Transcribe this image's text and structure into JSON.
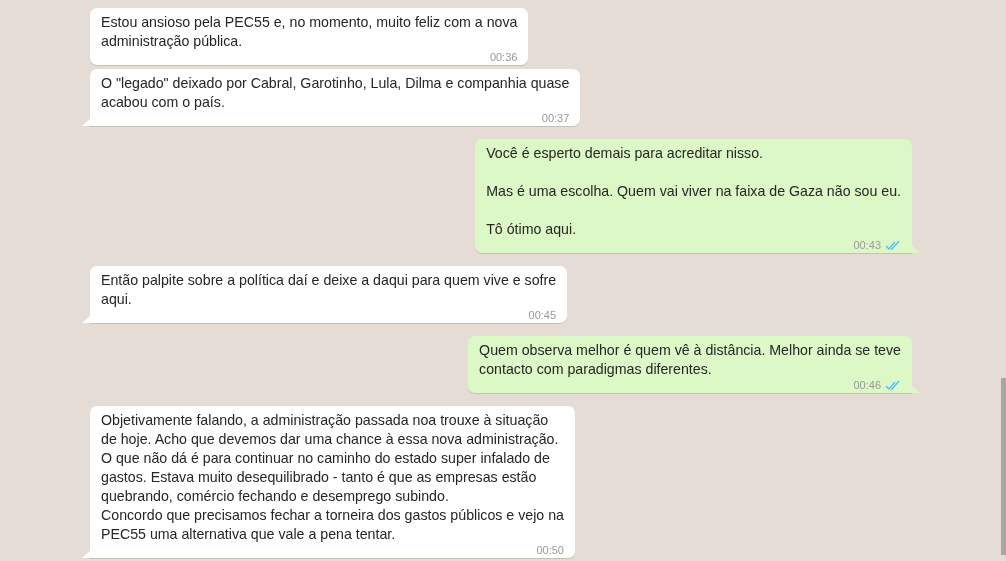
{
  "messages": [
    {
      "outgoing": false,
      "tail": false,
      "paragraphs": [
        "Estou ansioso pela PEC55 e, no momento, muito feliz com a nova\nadministração pública."
      ],
      "time": "00:36"
    },
    {
      "outgoing": false,
      "tail": true,
      "paragraphs": [
        "O \"legado\" deixado por Cabral, Garotinho, Lula, Dilma e companhia quase\nacabou com o país."
      ],
      "time": "00:37"
    },
    {
      "outgoing": true,
      "tail": true,
      "paragraphs": [
        "Você é esperto demais para acreditar nisso.",
        "Mas é uma escolha. Quem vai viver na faixa de Gaza não sou eu.",
        "Tô ótimo aqui."
      ],
      "time": "00:43",
      "read": true
    },
    {
      "outgoing": false,
      "tail": true,
      "paragraphs": [
        "Então palpite sobre a política daí e deixe a daqui para quem vive e sofre\naqui."
      ],
      "time": "00:45"
    },
    {
      "outgoing": true,
      "tail": true,
      "paragraphs": [
        "Quem observa melhor é quem vê à distância. Melhor ainda se teve\ncontacto com paradigmas diferentes."
      ],
      "time": "00:46",
      "read": true
    },
    {
      "outgoing": false,
      "tail": true,
      "paragraphs": [
        "Objetivamente falando, a administração passada noa trouxe à situação\nde hoje. Acho que devemos dar uma chance à essa nova administração.\nO que não dá é para continuar no caminho do estado super infalado de\ngastos. Estava muito desequilibrado - tanto é que as empresas estão\nquebrando, comércio fechando e desemprego subindo.\nConcordo que precisamos fechar a torneira dos gastos públicos e vejo na\nPEC55 uma alternativa que vale a pena tentar."
      ],
      "time": "00:50"
    }
  ]
}
